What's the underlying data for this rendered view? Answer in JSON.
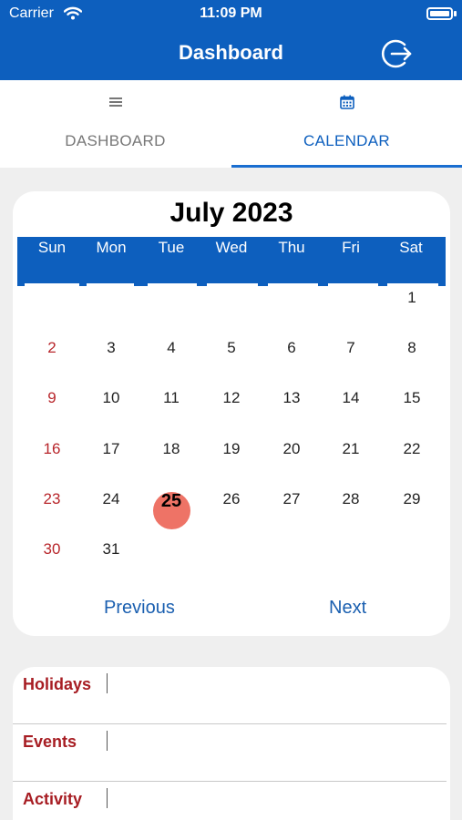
{
  "status_bar": {
    "carrier": "Carrier",
    "time": "11:09 PM"
  },
  "nav": {
    "title": "Dashboard"
  },
  "tabs": [
    {
      "label": "DASHBOARD",
      "icon": "menu-icon",
      "selected": false
    },
    {
      "label": "CALENDAR",
      "icon": "calendar-icon",
      "selected": true
    }
  ],
  "calendar": {
    "month_title": "July 2023",
    "weekdays": [
      "Sun",
      "Mon",
      "Tue",
      "Wed",
      "Thu",
      "Fri",
      "Sat"
    ],
    "days": [
      "1",
      "2",
      "3",
      "4",
      "5",
      "6",
      "7",
      "8",
      "9",
      "10",
      "11",
      "12",
      "13",
      "14",
      "15",
      "16",
      "17",
      "18",
      "19",
      "20",
      "21",
      "22",
      "23",
      "24",
      "25",
      "26",
      "27",
      "28",
      "29",
      "30",
      "31"
    ],
    "today": "25",
    "previous_label": "Previous",
    "next_label": "Next"
  },
  "sections": [
    {
      "label": "Holidays"
    },
    {
      "label": "Events"
    },
    {
      "label": "Activity"
    }
  ],
  "colors": {
    "brand_blue": "#0d5fbe",
    "sunday_red": "#b8262b",
    "today_marker": "#ee7366",
    "section_label_red": "#a71d23"
  }
}
